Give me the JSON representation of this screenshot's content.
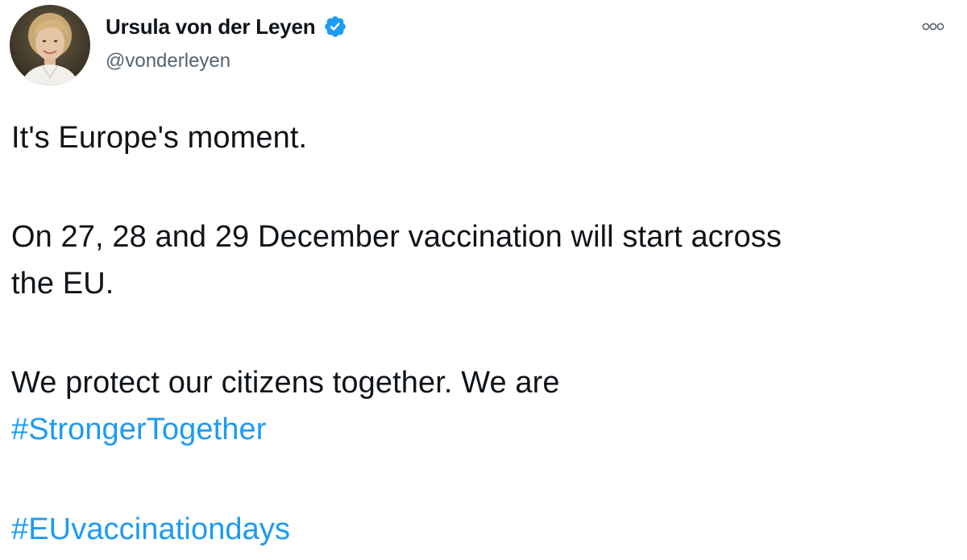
{
  "author": {
    "display_name": "Ursula von der Leyen",
    "handle": "@vonderleyen",
    "verified": true,
    "avatar_icon": "profile-photo-icon"
  },
  "tweet": {
    "line1": "It's Europe's moment.",
    "line2a": "On 27, 28 and 29 December vaccination will start across",
    "line2b": "the EU.",
    "line3": "We protect our citizens together. We are",
    "hashtag1": "#StrongerTogether",
    "hashtag2": "#EUvaccinationdays"
  },
  "icons": {
    "more": "more-options-icon",
    "verified": "verified-badge-icon"
  },
  "colors": {
    "link": "#1d9bf0",
    "text": "#0f1419",
    "secondary": "#536471",
    "verified": "#1d9bf0"
  }
}
